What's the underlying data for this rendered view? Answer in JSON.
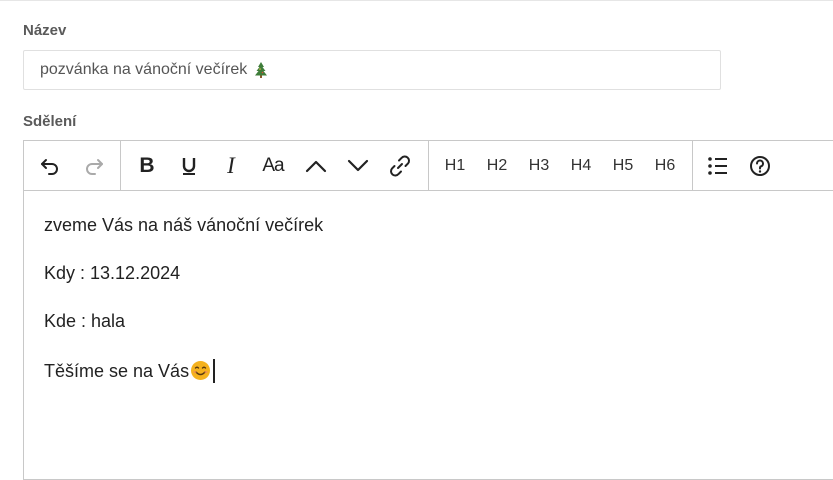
{
  "form": {
    "title_label": "Název",
    "title_value": "pozvánka na vánoční večírek",
    "title_emoji_icon": "christmas-tree-icon",
    "message_label": "Sdělení"
  },
  "toolbar": {
    "icons": [
      "undo-icon",
      "redo-icon",
      "bold-icon",
      "underline-icon",
      "italic-icon",
      "font-case-icon",
      "caret-up-icon",
      "caret-down-icon",
      "link-icon",
      "bulleted-list-icon",
      "help-icon"
    ],
    "headings": [
      "H1",
      "H2",
      "H3",
      "H4",
      "H5",
      "H6"
    ],
    "bold_label": "B",
    "italic_label": "I",
    "case_label": "Aa"
  },
  "editor": {
    "paragraphs": [
      "zveme Vás na náš vánoční večírek",
      "Kdy : 13.12.2024",
      "Kde : hala",
      "Těšíme se na Vás"
    ],
    "last_emoji_icon": "smiling-face-icon"
  },
  "colors": {
    "label": "#5a5a5a",
    "border": "#c8c8c8",
    "emoji_face": "#f5b21e"
  }
}
